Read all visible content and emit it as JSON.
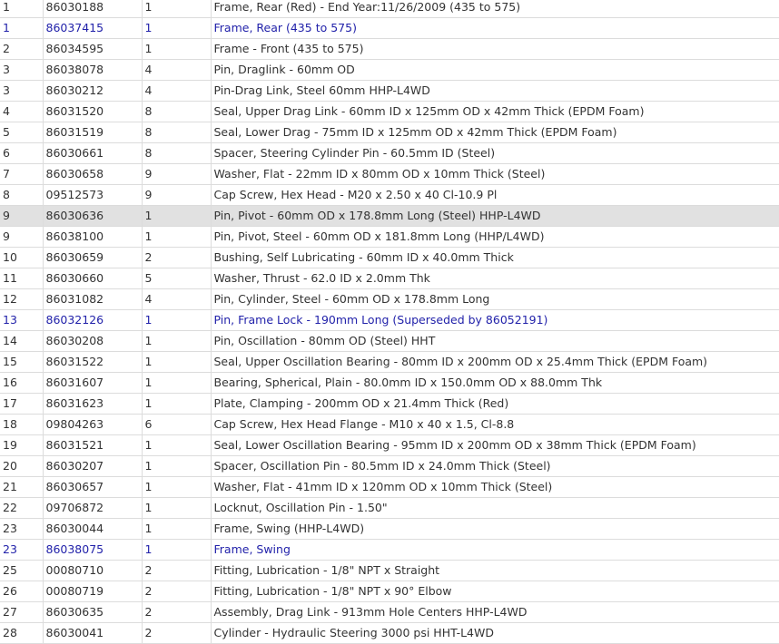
{
  "parts_table": {
    "rows": [
      {
        "ref": "1",
        "part_number": "86030188",
        "qty": "1",
        "description": "Frame, Rear (Red) - End Year:11/26/2009 (435 to 575)",
        "link": false,
        "selected": false
      },
      {
        "ref": "1",
        "part_number": "86037415",
        "qty": "1",
        "description": "Frame, Rear (435 to 575)",
        "link": true,
        "selected": false
      },
      {
        "ref": "2",
        "part_number": "86034595",
        "qty": "1",
        "description": "Frame - Front (435 to 575)",
        "link": false,
        "selected": false
      },
      {
        "ref": "3",
        "part_number": "86038078",
        "qty": "4",
        "description": "Pin, Draglink - 60mm OD",
        "link": false,
        "selected": false
      },
      {
        "ref": "3",
        "part_number": "86030212",
        "qty": "4",
        "description": "Pin-Drag Link, Steel 60mm HHP-L4WD",
        "link": false,
        "selected": false
      },
      {
        "ref": "4",
        "part_number": "86031520",
        "qty": "8",
        "description": "Seal, Upper Drag Link - 60mm ID x 125mm OD x 42mm Thick (EPDM Foam)",
        "link": false,
        "selected": false
      },
      {
        "ref": "5",
        "part_number": "86031519",
        "qty": "8",
        "description": "Seal, Lower Drag - 75mm ID x 125mm OD x 42mm Thick (EPDM Foam)",
        "link": false,
        "selected": false
      },
      {
        "ref": "6",
        "part_number": "86030661",
        "qty": "8",
        "description": "Spacer, Steering Cylinder Pin - 60.5mm ID (Steel)",
        "link": false,
        "selected": false
      },
      {
        "ref": "7",
        "part_number": "86030658",
        "qty": "9",
        "description": "Washer, Flat - 22mm ID x 80mm OD x 10mm Thick (Steel)",
        "link": false,
        "selected": false
      },
      {
        "ref": "8",
        "part_number": "09512573",
        "qty": "9",
        "description": "Cap Screw, Hex Head - M20 x 2.50 x 40 Cl-10.9 Pl",
        "link": false,
        "selected": false
      },
      {
        "ref": "9",
        "part_number": "86030636",
        "qty": "1",
        "description": "Pin, Pivot - 60mm OD x 178.8mm Long (Steel) HHP-L4WD",
        "link": false,
        "selected": true
      },
      {
        "ref": "9",
        "part_number": "86038100",
        "qty": "1",
        "description": "Pin, Pivot, Steel - 60mm OD x 181.8mm Long (HHP/L4WD)",
        "link": false,
        "selected": false
      },
      {
        "ref": "10",
        "part_number": "86030659",
        "qty": "2",
        "description": "Bushing, Self Lubricating - 60mm ID x 40.0mm Thick",
        "link": false,
        "selected": false
      },
      {
        "ref": "11",
        "part_number": "86030660",
        "qty": "5",
        "description": "Washer, Thrust - 62.0 ID x 2.0mm Thk",
        "link": false,
        "selected": false
      },
      {
        "ref": "12",
        "part_number": "86031082",
        "qty": "4",
        "description": "Pin, Cylinder, Steel - 60mm OD x 178.8mm Long",
        "link": false,
        "selected": false
      },
      {
        "ref": "13",
        "part_number": "86032126",
        "qty": "1",
        "description": "Pin, Frame Lock - 190mm Long (Superseded by 86052191)",
        "link": true,
        "selected": false
      },
      {
        "ref": "14",
        "part_number": "86030208",
        "qty": "1",
        "description": "Pin, Oscillation - 80mm OD (Steel) HHT",
        "link": false,
        "selected": false
      },
      {
        "ref": "15",
        "part_number": "86031522",
        "qty": "1",
        "description": "Seal, Upper Oscillation Bearing - 80mm ID x 200mm OD x 25.4mm Thick (EPDM Foam)",
        "link": false,
        "selected": false
      },
      {
        "ref": "16",
        "part_number": "86031607",
        "qty": "1",
        "description": "Bearing, Spherical, Plain - 80.0mm ID x 150.0mm OD x 88.0mm Thk",
        "link": false,
        "selected": false
      },
      {
        "ref": "17",
        "part_number": "86031623",
        "qty": "1",
        "description": "Plate, Clamping - 200mm OD x 21.4mm Thick (Red)",
        "link": false,
        "selected": false
      },
      {
        "ref": "18",
        "part_number": "09804263",
        "qty": "6",
        "description": "Cap Screw, Hex Head Flange - M10 x 40 x 1.5, Cl-8.8",
        "link": false,
        "selected": false
      },
      {
        "ref": "19",
        "part_number": "86031521",
        "qty": "1",
        "description": "Seal, Lower Oscillation Bearing - 95mm ID x 200mm OD x 38mm Thick (EPDM Foam)",
        "link": false,
        "selected": false
      },
      {
        "ref": "20",
        "part_number": "86030207",
        "qty": "1",
        "description": "Spacer, Oscillation Pin - 80.5mm ID x 24.0mm Thick (Steel)",
        "link": false,
        "selected": false
      },
      {
        "ref": "21",
        "part_number": "86030657",
        "qty": "1",
        "description": "Washer, Flat - 41mm ID x 120mm OD x 10mm Thick (Steel)",
        "link": false,
        "selected": false
      },
      {
        "ref": "22",
        "part_number": "09706872",
        "qty": "1",
        "description": "Locknut, Oscillation Pin - 1.50\"",
        "link": false,
        "selected": false
      },
      {
        "ref": "23",
        "part_number": "86030044",
        "qty": "1",
        "description": "Frame, Swing (HHP-L4WD)",
        "link": false,
        "selected": false
      },
      {
        "ref": "23",
        "part_number": "86038075",
        "qty": "1",
        "description": "Frame, Swing",
        "link": true,
        "selected": false
      },
      {
        "ref": "25",
        "part_number": "00080710",
        "qty": "2",
        "description": "Fitting, Lubrication - 1/8\" NPT x Straight",
        "link": false,
        "selected": false
      },
      {
        "ref": "26",
        "part_number": "00080719",
        "qty": "2",
        "description": "Fitting, Lubrication - 1/8\" NPT x 90° Elbow",
        "link": false,
        "selected": false
      },
      {
        "ref": "27",
        "part_number": "86030635",
        "qty": "2",
        "description": "Assembly, Drag Link - 913mm Hole Centers HHP-L4WD",
        "link": false,
        "selected": false
      },
      {
        "ref": "28",
        "part_number": "86030041",
        "qty": "2",
        "description": "Cylinder - Hydraulic Steering 3000 psi HHT-L4WD",
        "link": false,
        "selected": false
      }
    ]
  }
}
